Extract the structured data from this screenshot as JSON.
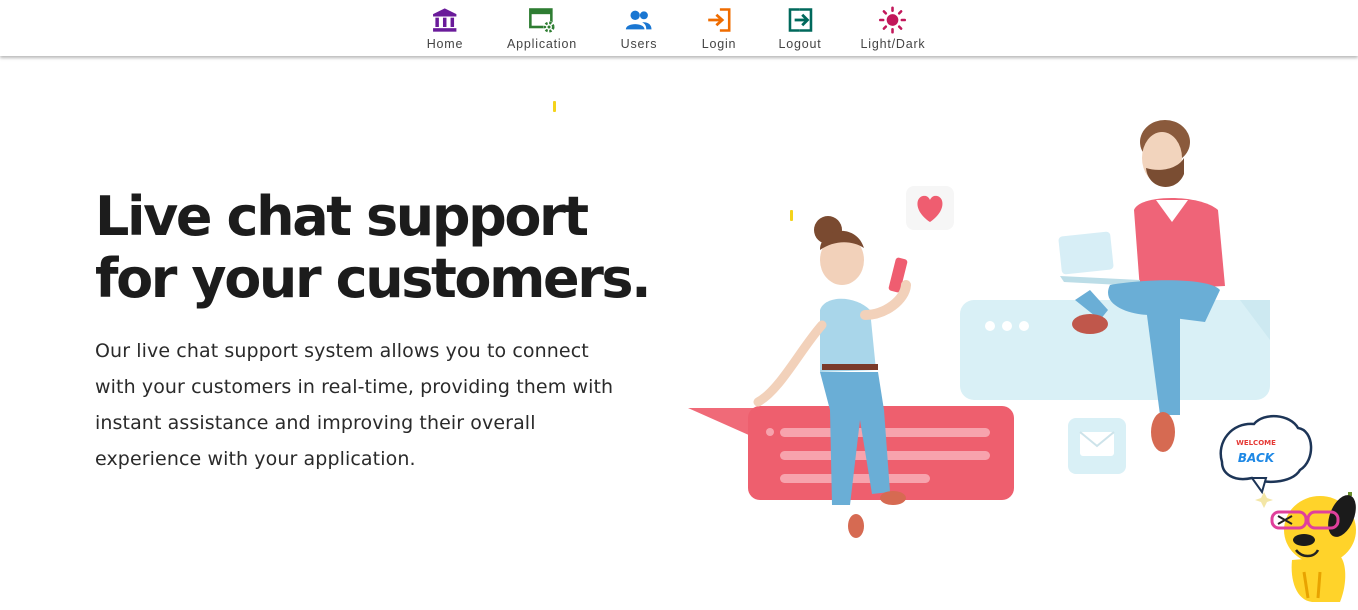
{
  "nav": {
    "items": [
      {
        "label": "Home",
        "icon": "bank-icon",
        "color": "#6a1b9a"
      },
      {
        "label": "Application",
        "icon": "app-settings-icon",
        "color": "#2e7d32"
      },
      {
        "label": "Users",
        "icon": "users-icon",
        "color": "#1976d2"
      },
      {
        "label": "Login",
        "icon": "login-icon",
        "color": "#ef6c00"
      },
      {
        "label": "Logout",
        "icon": "logout-icon",
        "color": "#00695c"
      },
      {
        "label": "Light/Dark",
        "icon": "sun-icon",
        "color": "#c2185b"
      }
    ]
  },
  "hero": {
    "title_lines": [
      "Live chat support",
      "for your customers."
    ],
    "description_lines": [
      "Our live chat support system allows you to connect",
      "with your customers in real-time, providing them with",
      "instant assistance and improving their overall",
      "experience with your application."
    ]
  },
  "mascot": {
    "bubble_top": "WELCOME",
    "bubble_bottom": "BACK"
  }
}
